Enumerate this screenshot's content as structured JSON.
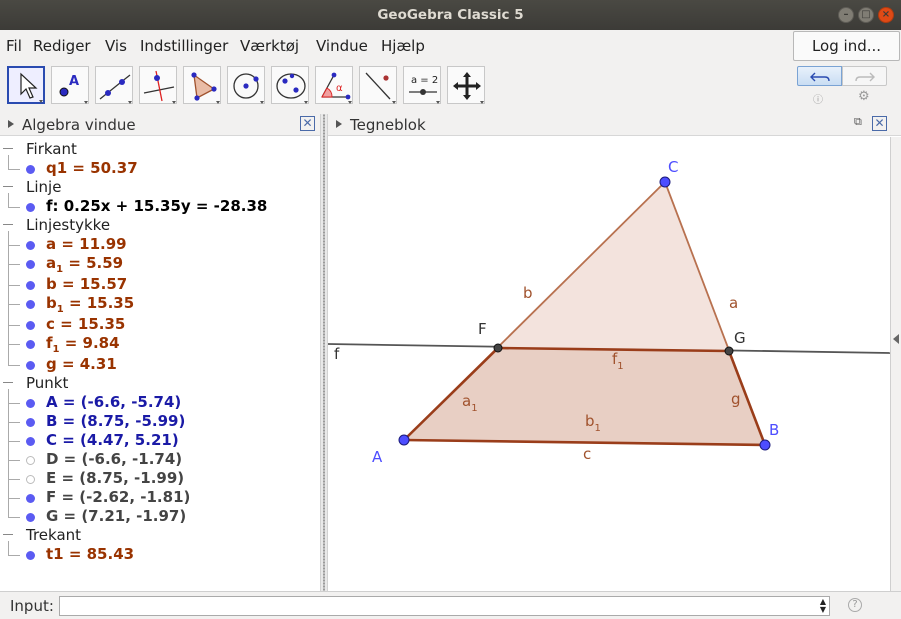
{
  "window": {
    "title": "GeoGebra Classic 5"
  },
  "menu": {
    "items": [
      "Fil",
      "Rediger",
      "Vis",
      "Indstillinger",
      "Værktøj",
      "Vindue",
      "Hjælp"
    ],
    "login": "Log ind..."
  },
  "toolbar": {
    "tools": [
      "move-tool",
      "point-tool",
      "line-tool",
      "perpendicular-line-tool",
      "polygon-tool",
      "circle-tool",
      "conic-tool",
      "angle-tool",
      "reflect-tool",
      "slider-tool",
      "move-graphics-view-tool"
    ],
    "slider_label": "a = 2",
    "angle_label": "α"
  },
  "algebra": {
    "title": "Algebra vindue",
    "categories": [
      {
        "name": "Firkant",
        "items": [
          {
            "text": "q1 = 50.37",
            "color": "#993300"
          }
        ]
      },
      {
        "name": "Linje",
        "items": [
          {
            "text": "f: 0.25x + 15.35y = -28.38",
            "color": "#000000"
          }
        ]
      },
      {
        "name": "Linjestykke",
        "items": [
          {
            "text": "a = 11.99",
            "color": "#993300"
          },
          {
            "pre": "a",
            "sub": "1",
            "post": " = 5.59",
            "color": "#993300"
          },
          {
            "text": "b = 15.57",
            "color": "#993300"
          },
          {
            "pre": "b",
            "sub": "1",
            "post": " = 15.35",
            "color": "#993300"
          },
          {
            "text": "c = 15.35",
            "color": "#993300"
          },
          {
            "pre": "f",
            "sub": "1",
            "post": " = 9.84",
            "color": "#993300"
          },
          {
            "text": "g = 4.31",
            "color": "#993300"
          }
        ]
      },
      {
        "name": "Punkt",
        "items": [
          {
            "text": "A = (-6.6, -5.74)",
            "color": "#1a1aa6"
          },
          {
            "text": "B = (8.75, -5.99)",
            "color": "#1a1aa6"
          },
          {
            "text": "C = (4.47, 5.21)",
            "color": "#1a1aa6"
          },
          {
            "text": "D = (-6.6, -1.74)",
            "color": "#444444",
            "hidden": true
          },
          {
            "text": "E = (8.75, -1.99)",
            "color": "#444444",
            "hidden": true
          },
          {
            "text": "F = (-2.62, -1.81)",
            "color": "#444444"
          },
          {
            "text": "G = (7.21, -1.97)",
            "color": "#444444"
          }
        ]
      },
      {
        "name": "Trekant",
        "items": [
          {
            "text": "t1 = 85.43",
            "color": "#993300"
          }
        ]
      }
    ]
  },
  "graphics": {
    "title": "Tegneblok",
    "labels": {
      "A": "A",
      "B": "B",
      "C": "C",
      "F": "F",
      "G": "G",
      "a": "a",
      "b": "b",
      "c": "c",
      "g": "g",
      "f": "f",
      "a1": "a",
      "a1_sub": "1",
      "b1": "b",
      "b1_sub": "1",
      "f1": "f",
      "f1_sub": "1"
    },
    "colors": {
      "poly_edge": "#a0522d",
      "poly_fill": "#e9d2c7",
      "point": "#4d4dff",
      "line": "#555555"
    }
  },
  "input": {
    "label": "Input:",
    "value": "",
    "help": "?"
  }
}
